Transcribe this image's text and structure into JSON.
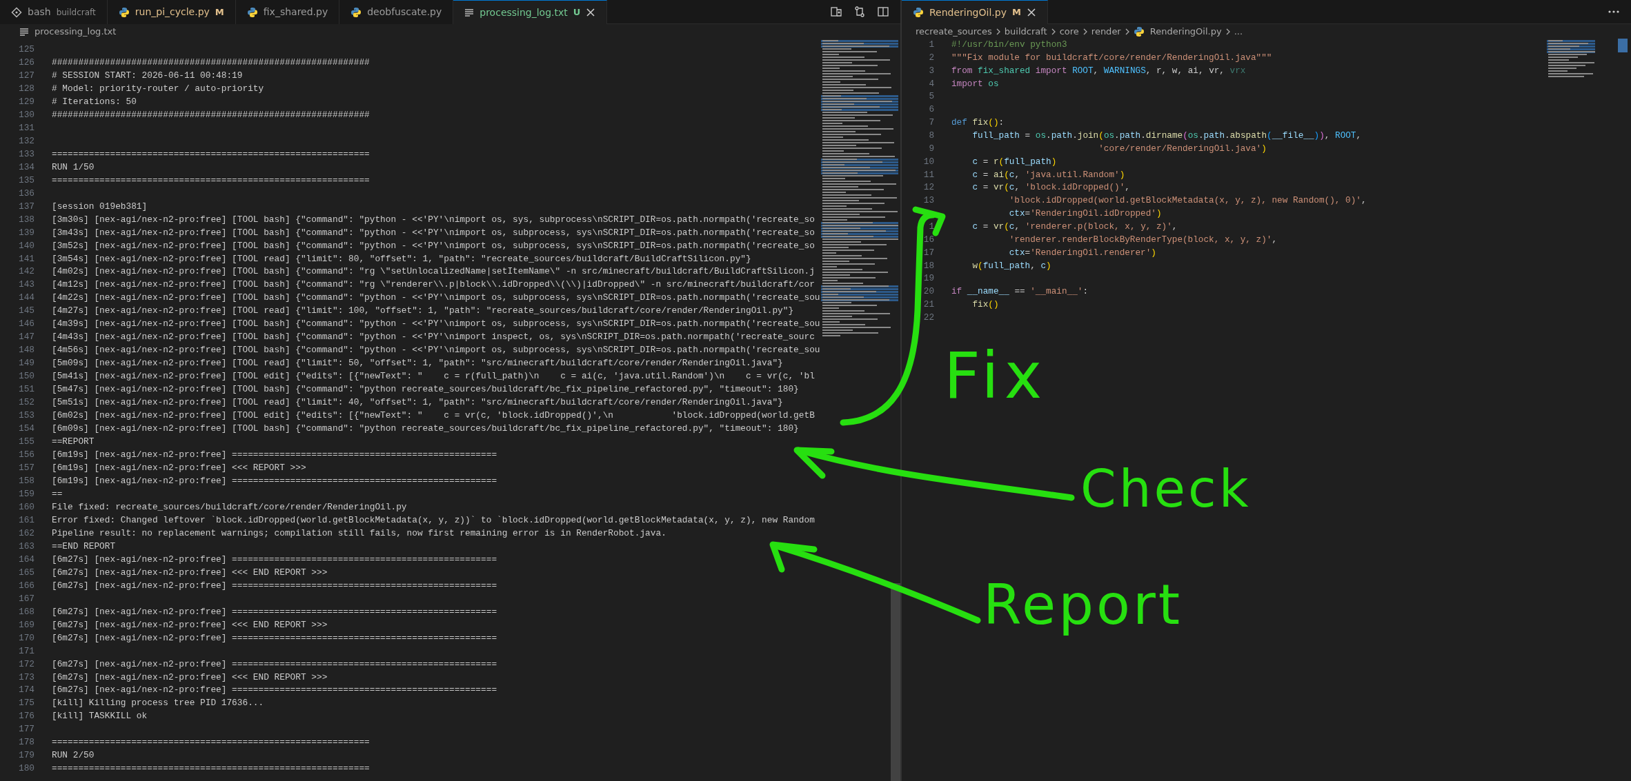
{
  "left_editor": {
    "tabs": [
      {
        "label": "bash",
        "description": "buildcraft",
        "kind": "terminal",
        "selected": false
      },
      {
        "label": "run_pi_cycle.py",
        "badge": "M",
        "modified": true,
        "kind": "python",
        "selected": false
      },
      {
        "label": "fix_shared.py",
        "kind": "python",
        "selected": false
      },
      {
        "label": "deobfuscate.py",
        "kind": "python",
        "selected": false
      },
      {
        "label": "processing_log.txt",
        "badge": "U",
        "untracked": true,
        "kind": "text",
        "selected": true
      }
    ],
    "breadcrumb": [
      {
        "text": "processing_log.txt",
        "kind": "text"
      }
    ],
    "lines": [
      {
        "number": "125"
      },
      {
        "number": "126",
        "text": "############################################################"
      },
      {
        "number": "127",
        "text": "# SESSION START: 2026-06-11 00:48:19"
      },
      {
        "number": "128",
        "text": "# Model: priority-router / auto-priority"
      },
      {
        "number": "129",
        "text": "# Iterations: 50"
      },
      {
        "number": "130",
        "text": "############################################################"
      },
      {
        "number": "131"
      },
      {
        "number": "132"
      },
      {
        "number": "133",
        "text": "============================================================"
      },
      {
        "number": "134",
        "text": "RUN 1/50"
      },
      {
        "number": "135",
        "text": "============================================================"
      },
      {
        "number": "136"
      },
      {
        "number": "137",
        "text": "[session 019eb381]"
      },
      {
        "number": "138",
        "text": "[3m30s] [nex-agi/nex-n2-pro:free] [TOOL bash] {\"command\": \"python - <<'PY'\\nimport os, sys, subprocess\\nSCRIPT_DIR=os.path.normpath('recreate_so"
      },
      {
        "number": "139",
        "text": "[3m43s] [nex-agi/nex-n2-pro:free] [TOOL bash] {\"command\": \"python - <<'PY'\\nimport os, subprocess, sys\\nSCRIPT_DIR=os.path.normpath('recreate_so"
      },
      {
        "number": "140",
        "text": "[3m52s] [nex-agi/nex-n2-pro:free] [TOOL bash] {\"command\": \"python - <<'PY'\\nimport os, subprocess, sys\\nSCRIPT_DIR=os.path.normpath('recreate_so"
      },
      {
        "number": "141",
        "text": "[3m54s] [nex-agi/nex-n2-pro:free] [TOOL read] {\"limit\": 80, \"offset\": 1, \"path\": \"recreate_sources/buildcraft/BuildCraftSilicon.py\"}"
      },
      {
        "number": "142",
        "text": "[4m02s] [nex-agi/nex-n2-pro:free] [TOOL bash] {\"command\": \"rg \\\"setUnlocalizedName|setItemName\\\" -n src/minecraft/buildcraft/BuildCraftSilicon.j"
      },
      {
        "number": "143",
        "text": "[4m12s] [nex-agi/nex-n2-pro:free] [TOOL bash] {\"command\": \"rg \\\"renderer\\\\.p|block\\\\.idDropped\\\\(\\\\)|idDropped\\\" -n src/minecraft/buildcraft/cor"
      },
      {
        "number": "144",
        "text": "[4m22s] [nex-agi/nex-n2-pro:free] [TOOL bash] {\"command\": \"python - <<'PY'\\nimport os, subprocess, sys\\nSCRIPT_DIR=os.path.normpath('recreate_sou"
      },
      {
        "number": "145",
        "text": "[4m27s] [nex-agi/nex-n2-pro:free] [TOOL read] {\"limit\": 100, \"offset\": 1, \"path\": \"recreate_sources/buildcraft/core/render/RenderingOil.py\"}"
      },
      {
        "number": "146",
        "text": "[4m39s] [nex-agi/nex-n2-pro:free] [TOOL bash] {\"command\": \"python - <<'PY'\\nimport os, subprocess, sys\\nSCRIPT_DIR=os.path.normpath('recreate_sou"
      },
      {
        "number": "147",
        "text": "[4m43s] [nex-agi/nex-n2-pro:free] [TOOL bash] {\"command\": \"python - <<'PY'\\nimport inspect, os, sys\\nSCRIPT_DIR=os.path.normpath('recreate_sourc"
      },
      {
        "number": "148",
        "text": "[4m56s] [nex-agi/nex-n2-pro:free] [TOOL bash] {\"command\": \"python - <<'PY'\\nimport os, subprocess, sys\\nSCRIPT_DIR=os.path.normpath('recreate_sou"
      },
      {
        "number": "149",
        "text": "[5m09s] [nex-agi/nex-n2-pro:free] [TOOL read] {\"limit\": 50, \"offset\": 1, \"path\": \"src/minecraft/buildcraft/core/render/RenderingOil.java\"}"
      },
      {
        "number": "150",
        "text": "[5m41s] [nex-agi/nex-n2-pro:free] [TOOL edit] {\"edits\": [{\"newText\": \"    c = r(full_path)\\n    c = ai(c, 'java.util.Random')\\n    c = vr(c, 'bl"
      },
      {
        "number": "151",
        "text": "[5m47s] [nex-agi/nex-n2-pro:free] [TOOL bash] {\"command\": \"python recreate_sources/buildcraft/bc_fix_pipeline_refactored.py\", \"timeout\": 180}"
      },
      {
        "number": "152",
        "text": "[5m51s] [nex-agi/nex-n2-pro:free] [TOOL read] {\"limit\": 40, \"offset\": 1, \"path\": \"src/minecraft/buildcraft/core/render/RenderingOil.java\"}"
      },
      {
        "number": "153",
        "text": "[6m02s] [nex-agi/nex-n2-pro:free] [TOOL edit] {\"edits\": [{\"newText\": \"    c = vr(c, 'block.idDropped()',\\n           'block.idDropped(world.getB"
      },
      {
        "number": "154",
        "text": "[6m09s] [nex-agi/nex-n2-pro:free] [TOOL bash] {\"command\": \"python recreate_sources/buildcraft/bc_fix_pipeline_refactored.py\", \"timeout\": 180}"
      },
      {
        "number": "155",
        "text": "==REPORT"
      },
      {
        "number": "156",
        "text": "[6m19s] [nex-agi/nex-n2-pro:free] =================================================="
      },
      {
        "number": "157",
        "text": "[6m19s] [nex-agi/nex-n2-pro:free] <<< REPORT >>>"
      },
      {
        "number": "158",
        "text": "[6m19s] [nex-agi/nex-n2-pro:free] =================================================="
      },
      {
        "number": "159",
        "text": "=="
      },
      {
        "number": "160",
        "text": "File fixed: recreate_sources/buildcraft/core/render/RenderingOil.py"
      },
      {
        "number": "161",
        "text": "Error fixed: Changed leftover `block.idDropped(world.getBlockMetadata(x, y, z))` to `block.idDropped(world.getBlockMetadata(x, y, z), new Random"
      },
      {
        "number": "162",
        "text": "Pipeline result: no replacement warnings; compilation still fails, now first remaining error is in RenderRobot.java."
      },
      {
        "number": "163",
        "text": "==END REPORT"
      },
      {
        "number": "164",
        "text": "[6m27s] [nex-agi/nex-n2-pro:free] =================================================="
      },
      {
        "number": "165",
        "text": "[6m27s] [nex-agi/nex-n2-pro:free] <<< END REPORT >>>"
      },
      {
        "number": "166",
        "text": "[6m27s] [nex-agi/nex-n2-pro:free] =================================================="
      },
      {
        "number": "167"
      },
      {
        "number": "168",
        "text": "[6m27s] [nex-agi/nex-n2-pro:free] =================================================="
      },
      {
        "number": "169",
        "text": "[6m27s] [nex-agi/nex-n2-pro:free] <<< END REPORT >>>"
      },
      {
        "number": "170",
        "text": "[6m27s] [nex-agi/nex-n2-pro:free] =================================================="
      },
      {
        "number": "171"
      },
      {
        "number": "172",
        "text": "[6m27s] [nex-agi/nex-n2-pro:free] =================================================="
      },
      {
        "number": "173",
        "text": "[6m27s] [nex-agi/nex-n2-pro:free] <<< END REPORT >>>"
      },
      {
        "number": "174",
        "text": "[6m27s] [nex-agi/nex-n2-pro:free] =================================================="
      },
      {
        "number": "175",
        "text": "[kill] Killing process tree PID 17636..."
      },
      {
        "number": "176",
        "text": "[kill] TASKKILL ok"
      },
      {
        "number": "177"
      },
      {
        "number": "178",
        "text": "============================================================"
      },
      {
        "number": "179",
        "text": "RUN 2/50"
      },
      {
        "number": "180",
        "text": "============================================================"
      }
    ]
  },
  "right_editor": {
    "tabs": [
      {
        "label": "RenderingOil.py",
        "badge": "M",
        "modified": true,
        "kind": "python",
        "selected": true
      }
    ],
    "breadcrumb": [
      {
        "text": "recreate_sources",
        "kind": "folder"
      },
      {
        "text": "buildcraft",
        "kind": "folder"
      },
      {
        "text": "core",
        "kind": "folder"
      },
      {
        "text": "render",
        "kind": "folder"
      },
      {
        "text": "RenderingOil.py",
        "kind": "python"
      },
      {
        "text": "...",
        "kind": "more"
      }
    ],
    "lines": [
      {
        "number": "1",
        "tokens": [
          {
            "text": "#!/usr/bin/env python3",
            "kind": "comment"
          }
        ]
      },
      {
        "number": "2",
        "tokens": [
          {
            "text": "\"\"\"Fix module for buildcraft/core/render/RenderingOil.java\"\"\"",
            "kind": "string"
          }
        ]
      },
      {
        "number": "3",
        "tokens": [
          {
            "text": "from ",
            "kind": "keyword"
          },
          {
            "text": "fix_shared ",
            "kind": "module"
          },
          {
            "text": "import ",
            "kind": "keyword"
          },
          {
            "text": "ROOT",
            "kind": "constant"
          },
          {
            "text": ", ",
            "kind": "plain"
          },
          {
            "text": "WARNINGS",
            "kind": "constant"
          },
          {
            "text": ", r, w, ai, vr, ",
            "kind": "plain"
          },
          {
            "text": "vrx",
            "kind": "unused"
          }
        ]
      },
      {
        "number": "4",
        "tokens": [
          {
            "text": "import ",
            "kind": "keyword"
          },
          {
            "text": "os",
            "kind": "module"
          }
        ]
      },
      {
        "number": "5"
      },
      {
        "number": "6"
      },
      {
        "number": "7",
        "tokens": [
          {
            "text": "def ",
            "kind": "storage"
          },
          {
            "text": "fix",
            "kind": "function"
          },
          {
            "text": "()",
            "kind": "bracket1"
          },
          {
            "text": ":",
            "kind": "plain"
          }
        ]
      },
      {
        "number": "8",
        "tokens": [
          {
            "text": "    full_path",
            "kind": "variable"
          },
          {
            "text": " = ",
            "kind": "plain"
          },
          {
            "text": "os",
            "kind": "module"
          },
          {
            "text": ".",
            "kind": "plain"
          },
          {
            "text": "path",
            "kind": "variable"
          },
          {
            "text": ".",
            "kind": "plain"
          },
          {
            "text": "join",
            "kind": "function"
          },
          {
            "text": "(",
            "kind": "bracket1"
          },
          {
            "text": "os",
            "kind": "module"
          },
          {
            "text": ".",
            "kind": "plain"
          },
          {
            "text": "path",
            "kind": "variable"
          },
          {
            "text": ".",
            "kind": "plain"
          },
          {
            "text": "dirname",
            "kind": "function"
          },
          {
            "text": "(",
            "kind": "bracket2"
          },
          {
            "text": "os",
            "kind": "module"
          },
          {
            "text": ".",
            "kind": "plain"
          },
          {
            "text": "path",
            "kind": "variable"
          },
          {
            "text": ".",
            "kind": "plain"
          },
          {
            "text": "abspath",
            "kind": "function"
          },
          {
            "text": "(",
            "kind": "bracket3"
          },
          {
            "text": "__file__",
            "kind": "variable"
          },
          {
            "text": ")",
            "kind": "bracket3"
          },
          {
            "text": ")",
            "kind": "bracket2"
          },
          {
            "text": ", ",
            "kind": "plain"
          },
          {
            "text": "ROOT",
            "kind": "constant"
          },
          {
            "text": ",",
            "kind": "plain"
          }
        ]
      },
      {
        "number": "9",
        "tokens": [
          {
            "text": "                            'core/render/RenderingOil.java'",
            "kind": "string"
          },
          {
            "text": ")",
            "kind": "bracket1"
          }
        ]
      },
      {
        "number": "10",
        "tokens": [
          {
            "text": "    c",
            "kind": "variable"
          },
          {
            "text": " = ",
            "kind": "plain"
          },
          {
            "text": "r",
            "kind": "function"
          },
          {
            "text": "(",
            "kind": "bracket1"
          },
          {
            "text": "full_path",
            "kind": "variable"
          },
          {
            "text": ")",
            "kind": "bracket1"
          }
        ]
      },
      {
        "number": "11",
        "tokens": [
          {
            "text": "    c",
            "kind": "variable"
          },
          {
            "text": " = ",
            "kind": "plain"
          },
          {
            "text": "ai",
            "kind": "function"
          },
          {
            "text": "(",
            "kind": "bracket1"
          },
          {
            "text": "c",
            "kind": "variable"
          },
          {
            "text": ", ",
            "kind": "plain"
          },
          {
            "text": "'java.util.Random'",
            "kind": "string"
          },
          {
            "text": ")",
            "kind": "bracket1"
          }
        ]
      },
      {
        "number": "12",
        "tokens": [
          {
            "text": "    c",
            "kind": "variable"
          },
          {
            "text": " = ",
            "kind": "plain"
          },
          {
            "text": "vr",
            "kind": "function"
          },
          {
            "text": "(",
            "kind": "bracket1"
          },
          {
            "text": "c",
            "kind": "variable"
          },
          {
            "text": ", ",
            "kind": "plain"
          },
          {
            "text": "'block.idDropped()'",
            "kind": "string"
          },
          {
            "text": ",",
            "kind": "plain"
          }
        ]
      },
      {
        "number": "13",
        "tokens": [
          {
            "text": "           'block.idDropped(world.getBlockMetadata(x, y, z), new Random(), 0)'",
            "kind": "string"
          },
          {
            "text": ",",
            "kind": "plain"
          }
        ]
      },
      {
        "tokens": [
          {
            "text": "           ctx",
            "kind": "variable"
          },
          {
            "text": "=",
            "kind": "plain"
          },
          {
            "text": "'RenderingOil.idDropped'",
            "kind": "string"
          },
          {
            "text": ")",
            "kind": "bracket1"
          }
        ]
      },
      {
        "number": "1",
        "tokens": [
          {
            "text": "    c",
            "kind": "variable"
          },
          {
            "text": " = ",
            "kind": "plain"
          },
          {
            "text": "vr",
            "kind": "function"
          },
          {
            "text": "(",
            "kind": "bracket1"
          },
          {
            "text": "c",
            "kind": "variable"
          },
          {
            "text": ", ",
            "kind": "plain"
          },
          {
            "text": "'renderer.p(block, x, y, z)'",
            "kind": "string"
          },
          {
            "text": ",",
            "kind": "plain"
          }
        ]
      },
      {
        "number": "16",
        "tokens": [
          {
            "text": "           'renderer.renderBlockByRenderType(block, x, y, z)'",
            "kind": "string"
          },
          {
            "text": ",",
            "kind": "plain"
          }
        ]
      },
      {
        "number": "17",
        "tokens": [
          {
            "text": "           ctx",
            "kind": "variable"
          },
          {
            "text": "=",
            "kind": "plain"
          },
          {
            "text": "'RenderingOil.renderer'",
            "kind": "string"
          },
          {
            "text": ")",
            "kind": "bracket1"
          }
        ]
      },
      {
        "number": "18",
        "tokens": [
          {
            "text": "    w",
            "kind": "function"
          },
          {
            "text": "(",
            "kind": "bracket1"
          },
          {
            "text": "full_path",
            "kind": "variable"
          },
          {
            "text": ", ",
            "kind": "plain"
          },
          {
            "text": "c",
            "kind": "variable"
          },
          {
            "text": ")",
            "kind": "bracket1"
          }
        ]
      },
      {
        "number": "19"
      },
      {
        "number": "20",
        "tokens": [
          {
            "text": "if ",
            "kind": "keyword"
          },
          {
            "text": "__name__",
            "kind": "variable"
          },
          {
            "text": " == ",
            "kind": "plain"
          },
          {
            "text": "'__main__'",
            "kind": "string"
          },
          {
            "text": ":",
            "kind": "plain"
          }
        ]
      },
      {
        "number": "21",
        "tokens": [
          {
            "text": "    fix",
            "kind": "function"
          },
          {
            "text": "()",
            "kind": "bracket1"
          }
        ]
      },
      {
        "number": "22"
      }
    ]
  },
  "annotations": [
    {
      "text": "Fix"
    },
    {
      "text": "Check"
    },
    {
      "text": "Report"
    }
  ]
}
